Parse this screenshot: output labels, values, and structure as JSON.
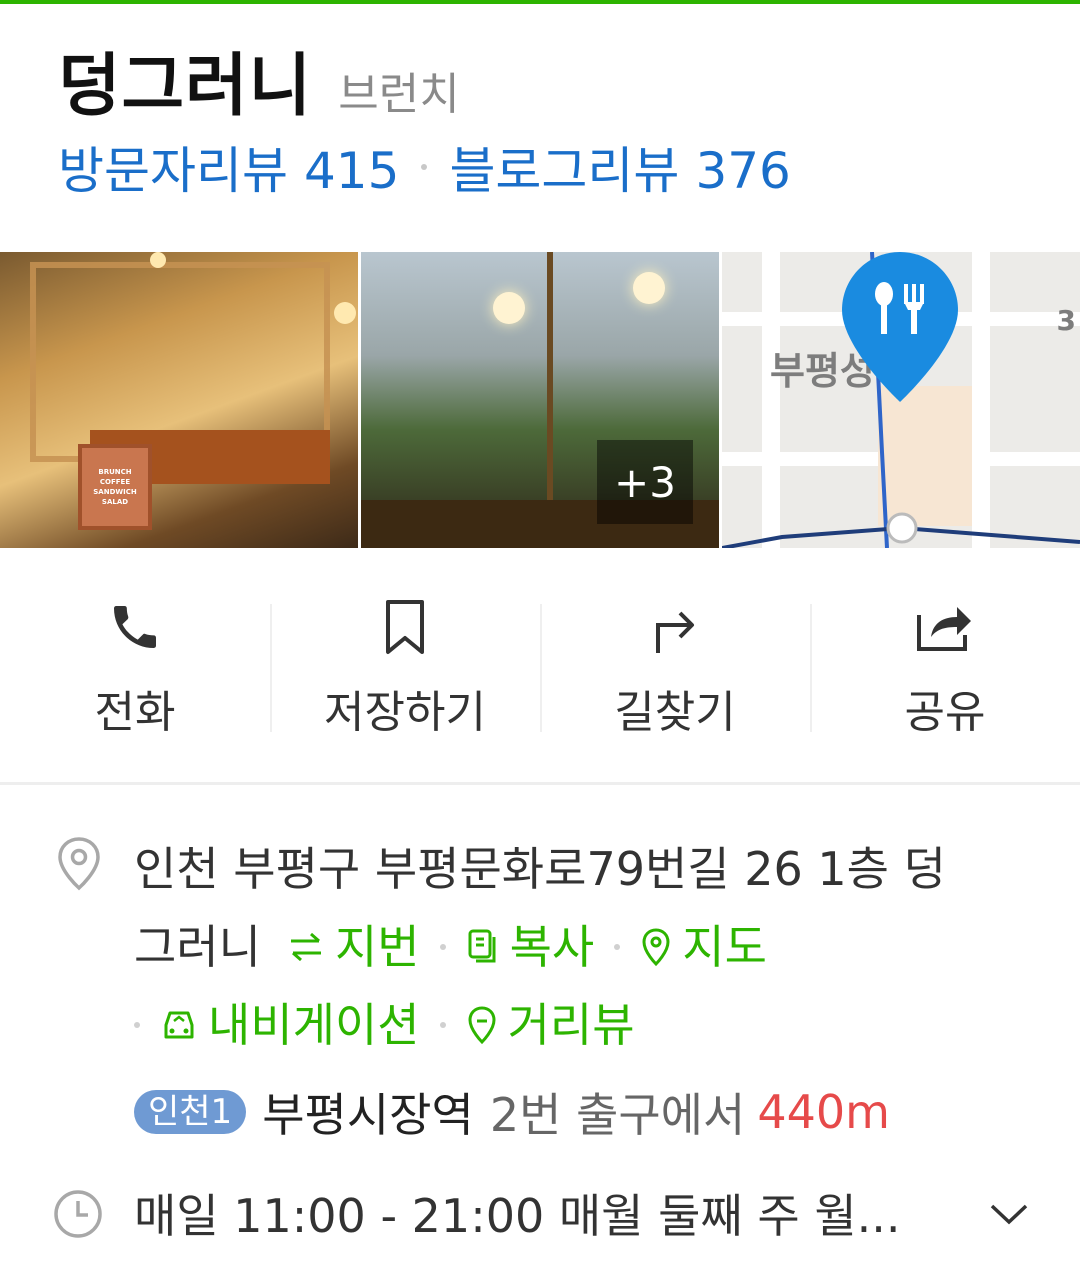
{
  "place": {
    "name": "덩그러니",
    "category": "브런치"
  },
  "reviews": {
    "visitor_label": "방문자리뷰",
    "visitor_count": "415",
    "blog_label": "블로그리뷰",
    "blog_count": "376"
  },
  "photos": {
    "more_count": "+3",
    "sign_lines": [
      "BRUNCH",
      "COFFEE",
      "SANDWICH",
      "SALAD"
    ],
    "map_label": "부평성",
    "map_label_2": "3"
  },
  "actions": [
    {
      "label": "전화",
      "icon": "phone-icon"
    },
    {
      "label": "저장하기",
      "icon": "bookmark-icon"
    },
    {
      "label": "길찾기",
      "icon": "directions-icon"
    },
    {
      "label": "공유",
      "icon": "share-icon"
    }
  ],
  "address": {
    "line1": "인천 부평구 부평문화로79번길 26 1층 덩",
    "line2_text": "그러니",
    "links": {
      "jibun": "지번",
      "copy": "복사",
      "map": "지도",
      "navigation": "내비게이션",
      "street_view": "거리뷰"
    }
  },
  "subway": {
    "line": "인천1",
    "station": "부평시장역",
    "exit": "2번 출구에서",
    "distance": "440m"
  },
  "hours": {
    "text": "매일 11:00 - 21:00 매월 둘째 주 월..."
  },
  "colors": {
    "accent_green": "#2db400",
    "link_blue": "#1a6ec9",
    "distance_red": "#e64a4a",
    "subway_badge": "#6f9ad3",
    "map_pin": "#1a8be0"
  }
}
